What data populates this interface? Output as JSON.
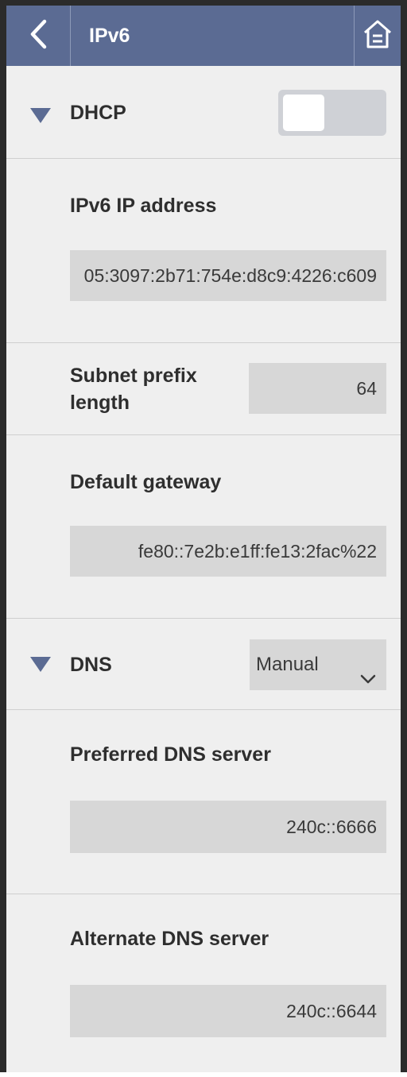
{
  "header": {
    "title": "IPv6",
    "back_icon": "chevron-left-icon",
    "home_icon": "home-icon"
  },
  "dhcp": {
    "label": "DHCP",
    "enabled": false
  },
  "ip_address": {
    "label": "IPv6 IP address",
    "value": "05:3097:2b71:754e:d8c9:4226:c609"
  },
  "subnet": {
    "label_line1": "Subnet prefix",
    "label_line2": "length",
    "value": "64"
  },
  "gateway": {
    "label": "Default gateway",
    "value": "fe80::7e2b:e1ff:fe13:2fac%22"
  },
  "dns": {
    "label": "DNS",
    "mode": "Manual"
  },
  "preferred_dns": {
    "label": "Preferred DNS server",
    "value": "240c::6666"
  },
  "alternate_dns": {
    "label": "Alternate DNS server",
    "value": "240c::6644"
  },
  "colors": {
    "header_bg": "#5b6b93",
    "page_bg": "#efefef",
    "field_bg": "#d7d7d7",
    "accent": "#5b6b93"
  }
}
